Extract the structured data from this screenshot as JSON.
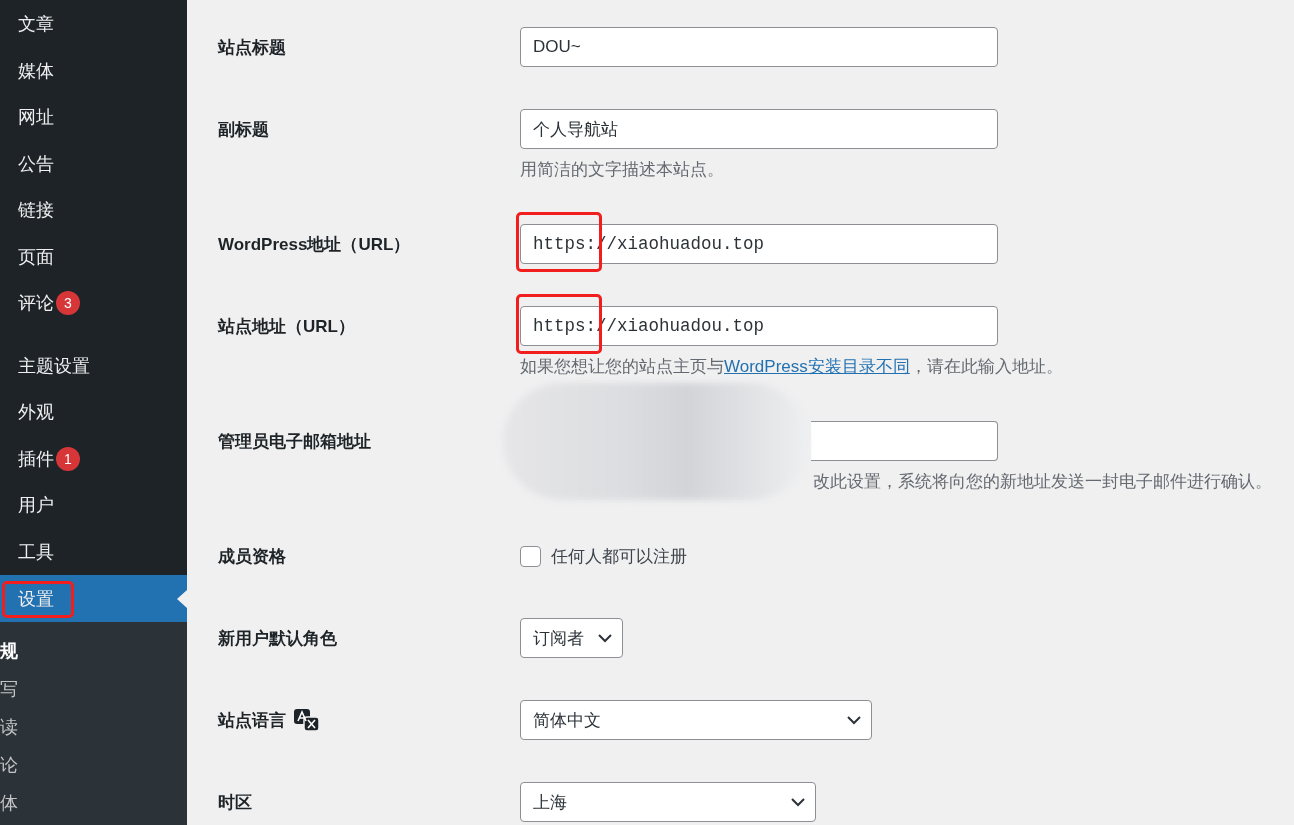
{
  "sidebar": {
    "items": [
      {
        "kind": "link",
        "label": "文章",
        "selected": false,
        "annotated": false
      },
      {
        "kind": "link",
        "label": "媒体",
        "selected": false,
        "annotated": false
      },
      {
        "kind": "link",
        "label": "网址",
        "selected": false,
        "annotated": false
      },
      {
        "kind": "link",
        "label": "公告",
        "selected": false,
        "annotated": false
      },
      {
        "kind": "link",
        "label": "链接",
        "selected": false,
        "annotated": false
      },
      {
        "kind": "link",
        "label": "页面",
        "selected": false,
        "annotated": false
      },
      {
        "kind": "link",
        "label": "评论",
        "badge": "3",
        "selected": false,
        "annotated": false
      },
      {
        "kind": "separator"
      },
      {
        "kind": "link",
        "label": "主题设置",
        "selected": false,
        "annotated": false
      },
      {
        "kind": "link",
        "label": "外观",
        "selected": false,
        "annotated": false
      },
      {
        "kind": "link",
        "label": "插件",
        "badge": "1",
        "selected": false,
        "annotated": false
      },
      {
        "kind": "link",
        "label": "用户",
        "selected": false,
        "annotated": false
      },
      {
        "kind": "link",
        "label": "工具",
        "selected": false,
        "annotated": false
      },
      {
        "kind": "link",
        "label": "设置",
        "selected": true,
        "annotated": true
      }
    ],
    "submenu": [
      {
        "label": "规",
        "selected": true
      },
      {
        "label": "写",
        "selected": false
      },
      {
        "label": "读",
        "selected": false
      },
      {
        "label": "论",
        "selected": false
      },
      {
        "label": "体",
        "selected": false
      }
    ]
  },
  "settings": [
    {
      "kind": "text",
      "label": "站点标题",
      "value": "DOU~",
      "annotated": false
    },
    {
      "kind": "text",
      "label": "副标题",
      "value": "个人导航站",
      "help": "用简洁的文字描述本站点。",
      "annotated": false
    },
    {
      "kind": "url",
      "label": "WordPress地址（URL）",
      "value": "https://xiaohuadou.top",
      "annotated": true
    },
    {
      "kind": "url",
      "label": "站点地址（URL）",
      "value": "https://xiaohuadou.top",
      "annotated": true,
      "help": "如果您想让您的站点主页与",
      "help_link": "WordPress安装目录不同",
      "help_after": "，请在此输入地址。"
    },
    {
      "kind": "hidden",
      "label": "管理员电子邮箱地址",
      "help": "改此设置，系统将向您的新地址发送一封电子邮件进行确认。",
      "annotated": false
    },
    {
      "kind": "checkbox",
      "label": "成员资格",
      "option": "任何人都可以注册",
      "checked": false,
      "annotated": false
    },
    {
      "kind": "compact-select",
      "label": "新用户默认角色",
      "value": "订阅者",
      "annotated": false
    },
    {
      "kind": "wide-select",
      "label": "站点语言",
      "value": "简体中文",
      "translate_icon": true,
      "annotated": false
    },
    {
      "kind": "select",
      "label": "时区",
      "value": "上海",
      "annotated": false
    }
  ]
}
